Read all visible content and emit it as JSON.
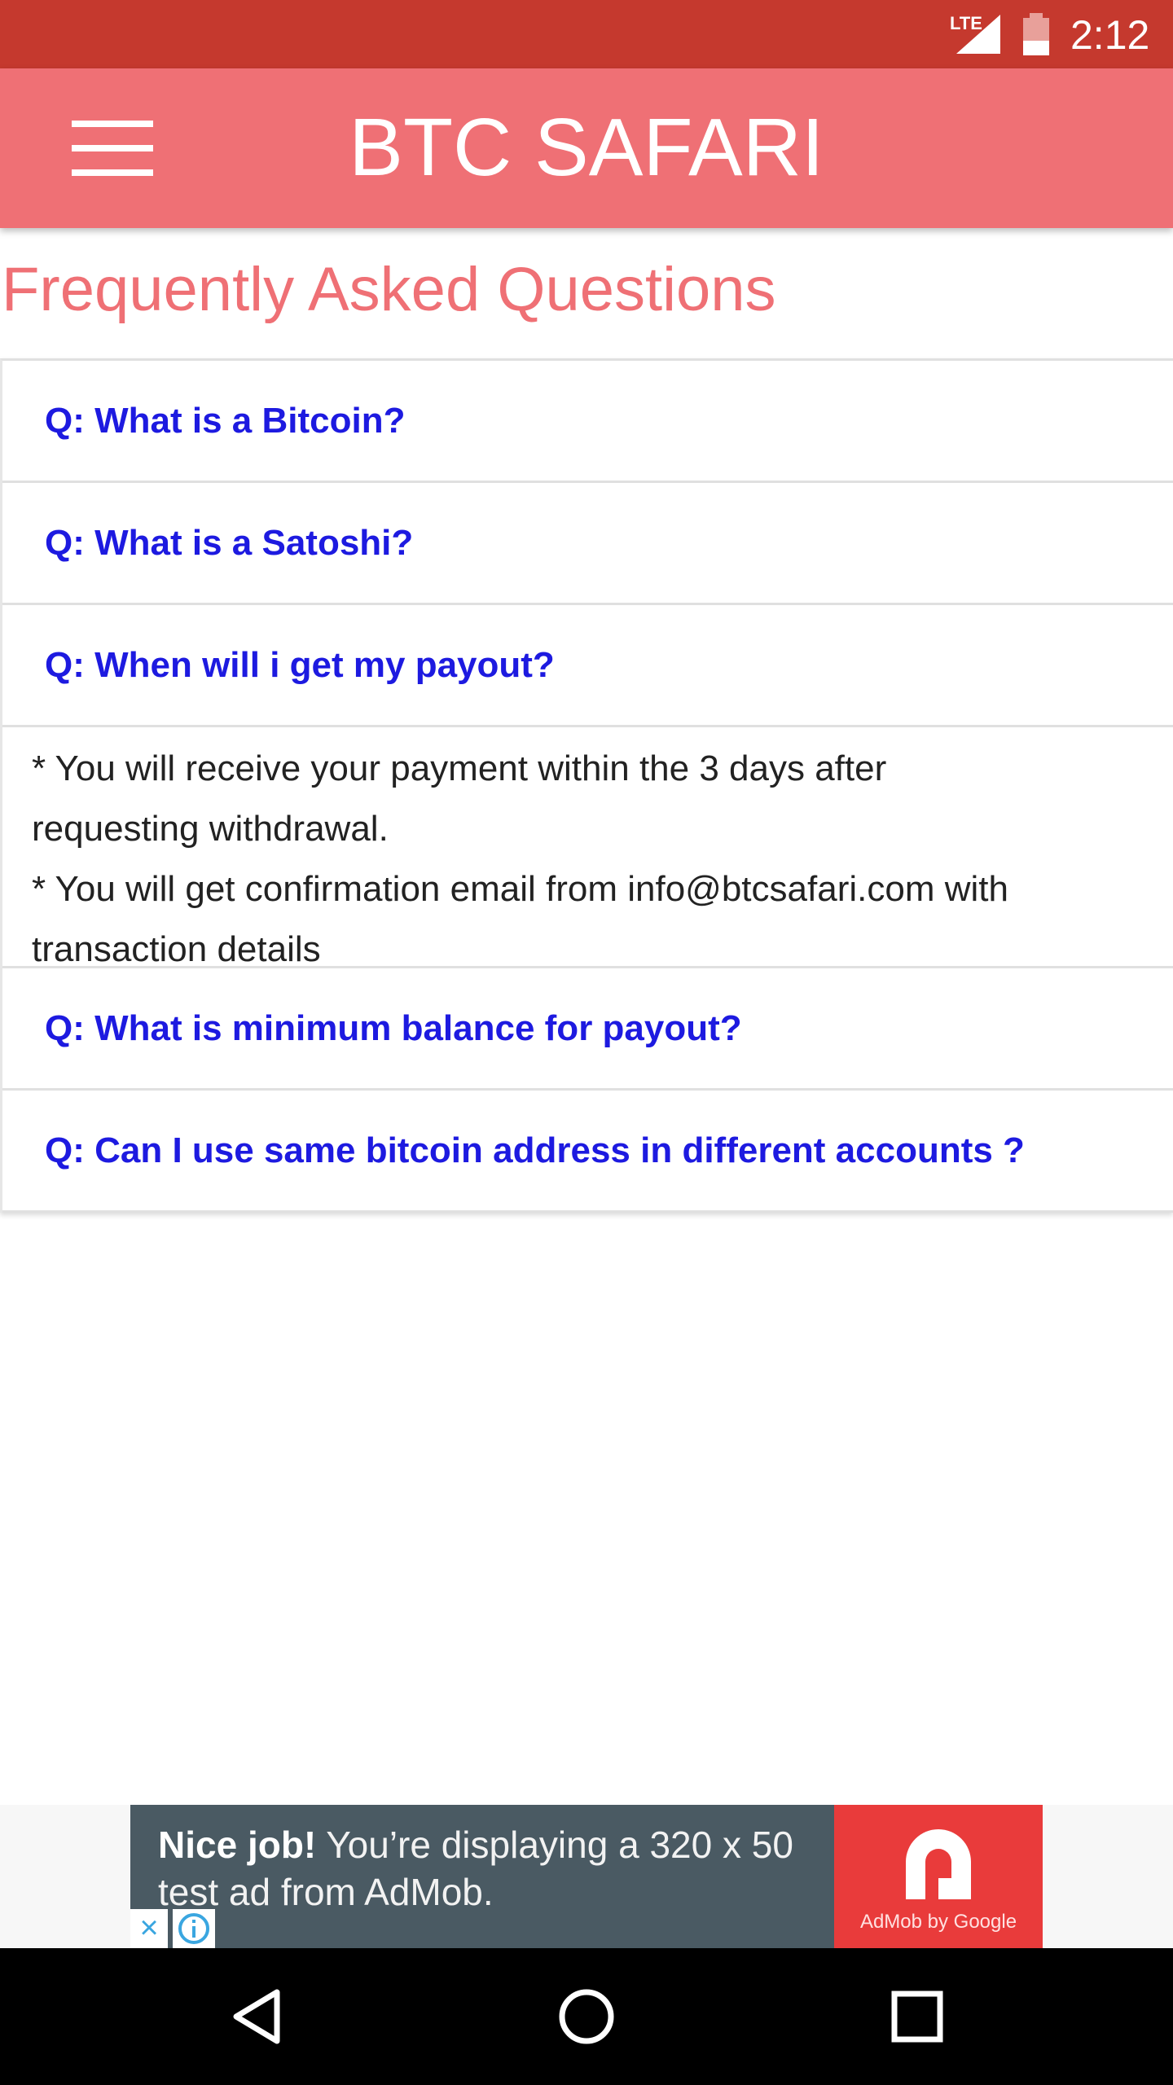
{
  "status_bar": {
    "network": "LTE",
    "time": "2:12",
    "icons": [
      "lte-signal-icon",
      "battery-icon"
    ],
    "color": "#c5392e"
  },
  "app_bar": {
    "title": "BTC SAFARI",
    "menu_icon": "hamburger-menu-icon",
    "color": "#ef7075"
  },
  "faq": {
    "heading": "Frequently Asked Questions",
    "questions": [
      {
        "question": "Q: What is a Bitcoin?"
      },
      {
        "question": "Q: What is a Satoshi?"
      },
      {
        "question": "Q: When will i get my payout?",
        "answer_lines": [
          "* You will receive your payment within the 3 days after",
          "requesting withdrawal.",
          "* You will get confirmation email from info@btcsafari.com with",
          "transaction details"
        ]
      },
      {
        "question": "Q: What is minimum balance for payout?"
      },
      {
        "question": "Q: Can I use same bitcoin address in different accounts ?"
      }
    ],
    "question_color": "#1d1ae0"
  },
  "ad": {
    "headline": "Nice job!",
    "body": " You’re displaying a 320 x 50 test ad from AdMob.",
    "brand_caption": "AdMob by Google",
    "close_symbol": "×",
    "icons": [
      "ad-close-icon",
      "ad-info-icon",
      "admob-logo-icon"
    ]
  },
  "nav_bar": {
    "icons": [
      "back-icon",
      "home-icon",
      "recents-icon"
    ]
  }
}
